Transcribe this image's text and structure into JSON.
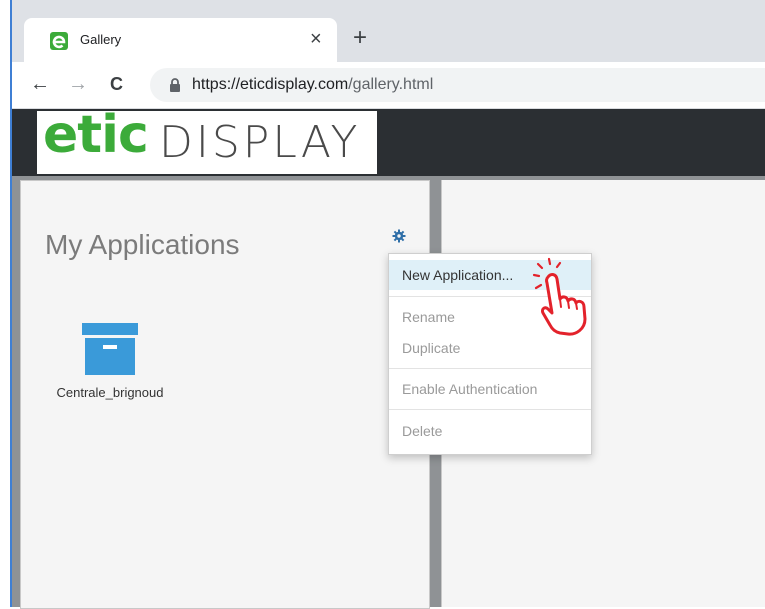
{
  "browser": {
    "tab_title": "Gallery",
    "tab_close": "×",
    "new_tab": "+",
    "url_host": "https://eticdisplay.com",
    "url_path": "/gallery.html",
    "nav_back": "←",
    "nav_forward": "→",
    "nav_reload": "C"
  },
  "app": {
    "logo_part1": "etic",
    "logo_part2": "DISPLAY",
    "brand_color": "#3cab3a"
  },
  "left_panel": {
    "title": "My Applications",
    "settings_icon": "gear-icon",
    "items": [
      {
        "label": "Centrale_brignoud",
        "icon": "archive-box-icon"
      }
    ]
  },
  "context_menu": {
    "items": [
      {
        "label": "New Application...",
        "state": "highlighted"
      },
      {
        "label": "Rename",
        "state": "disabled"
      },
      {
        "label": "Duplicate",
        "state": "disabled"
      },
      {
        "label": "Enable Authentication",
        "state": "disabled"
      },
      {
        "label": "Delete",
        "state": "disabled"
      }
    ]
  },
  "colors": {
    "accent_blue": "#3a9ad9",
    "header_bg": "#2b2f33",
    "menu_highlight": "#dff0f8",
    "pointer_red": "#e3222b"
  }
}
